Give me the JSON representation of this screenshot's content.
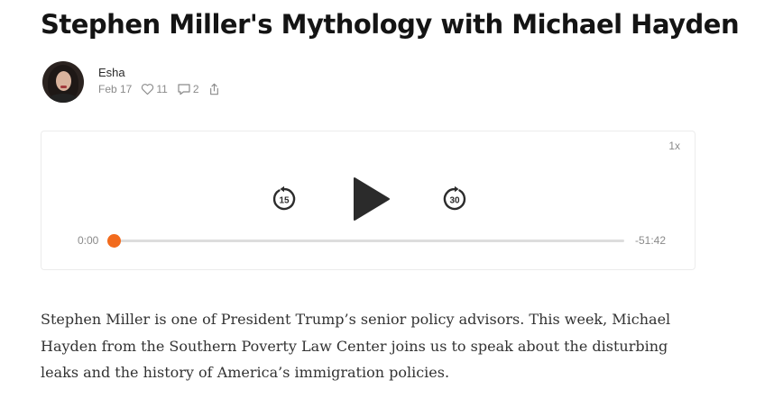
{
  "post": {
    "title": "Stephen Miller's Mythology with Michael Hayden",
    "author": "Esha",
    "date": "Feb 17",
    "likes": "11",
    "comments": "2",
    "description": "Stephen Miller is one of President Trump’s senior policy advisors. This week, Michael Hayden from the Southern Poverty Law Center joins us to speak about the disturbing leaks and the history of America’s immigration policies."
  },
  "player": {
    "speed": "1x",
    "skip_back_label": "15",
    "skip_forward_label": "30",
    "current_time": "0:00",
    "remaining_time": "-51:42",
    "progress": 0,
    "accent_color": "#f26b1d"
  },
  "icons": {
    "like": "heart-icon",
    "comment": "comment-icon",
    "share": "share-icon",
    "play": "play-icon",
    "skip_back": "rewind-15-icon",
    "skip_forward": "forward-30-icon"
  }
}
